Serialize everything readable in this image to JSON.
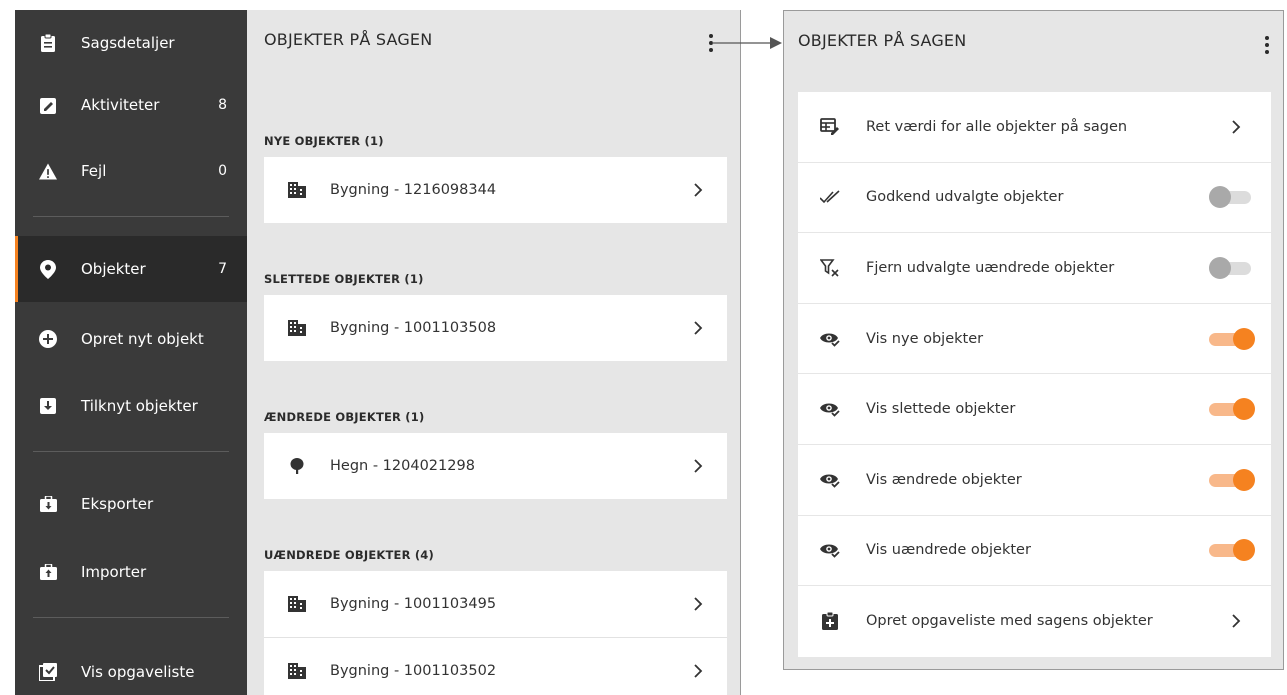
{
  "sidebar": {
    "items": [
      {
        "label": "Sagsdetaljer",
        "icon": "clipboard-icon"
      },
      {
        "label": "Aktiviteter",
        "count": "8",
        "icon": "edit-icon"
      },
      {
        "label": "Fejl",
        "count": "0",
        "icon": "warning-icon"
      },
      {
        "label": "Objekter",
        "count": "7",
        "icon": "map-pin-icon",
        "active": true
      },
      {
        "label": "Opret nyt objekt",
        "icon": "plus-circle-icon"
      },
      {
        "label": "Tilknyt objekter",
        "icon": "download-box-icon"
      },
      {
        "label": "Eksporter",
        "icon": "export-briefcase-icon"
      },
      {
        "label": "Importer",
        "icon": "import-briefcase-icon"
      },
      {
        "label": "Vis opgaveliste",
        "icon": "checklist-icon"
      }
    ]
  },
  "objects_panel": {
    "title": "OBJEKTER PÅ SAGEN",
    "sections": [
      {
        "heading": "NYE OBJEKTER (1)",
        "items": [
          {
            "label": "Bygning - 1216098344",
            "icon": "building-icon"
          }
        ]
      },
      {
        "heading": "SLETTEDE OBJEKTER (1)",
        "items": [
          {
            "label": "Bygning - 1001103508",
            "icon": "building-icon"
          }
        ]
      },
      {
        "heading": "ÆNDREDE OBJEKTER (1)",
        "items": [
          {
            "label": "Hegn - 1204021298",
            "icon": "tree-icon"
          }
        ]
      },
      {
        "heading": "UÆNDREDE OBJEKTER (4)",
        "items": [
          {
            "label": "Bygning - 1001103495",
            "icon": "building-icon"
          },
          {
            "label": "Bygning - 1001103502",
            "icon": "building-icon"
          }
        ]
      }
    ]
  },
  "menu_panel": {
    "title": "OBJEKTER PÅ SAGEN",
    "items": [
      {
        "label": "Ret værdi for alle objekter på sagen",
        "icon": "table-edit-icon",
        "type": "link"
      },
      {
        "label": "Godkend udvalgte objekter",
        "icon": "double-check-icon",
        "type": "toggle",
        "on": false
      },
      {
        "label": "Fjern udvalgte uændrede objekter",
        "icon": "filter-remove-icon",
        "type": "toggle",
        "on": false
      },
      {
        "label": "Vis nye objekter",
        "icon": "eye-check-icon",
        "type": "toggle",
        "on": true
      },
      {
        "label": "Vis slettede objekter",
        "icon": "eye-check-icon",
        "type": "toggle",
        "on": true
      },
      {
        "label": "Vis ændrede objekter",
        "icon": "eye-check-icon",
        "type": "toggle",
        "on": true
      },
      {
        "label": "Vis uændrede objekter",
        "icon": "eye-check-icon",
        "type": "toggle",
        "on": true
      },
      {
        "label": "Opret opgaveliste med sagens objekter",
        "icon": "clipboard-plus-icon",
        "type": "link"
      }
    ]
  },
  "colors": {
    "sidebar_bg": "#3a3a3a",
    "panel_bg": "#e6e6e6",
    "accent": "#f58220",
    "accent_light": "#f8b88a"
  }
}
